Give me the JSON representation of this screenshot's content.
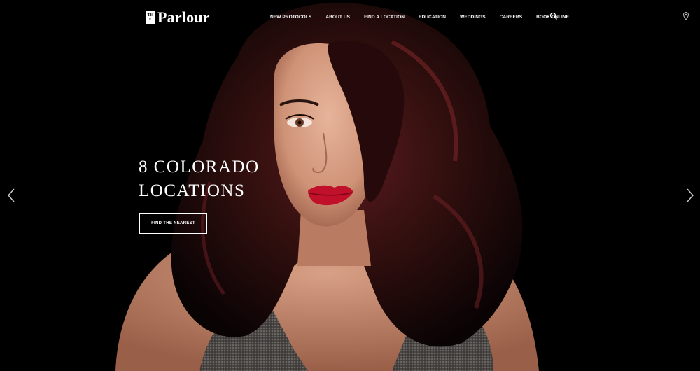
{
  "logo": {
    "the_line1": "TH",
    "the_line2": "E",
    "name": "Parlour"
  },
  "nav": [
    {
      "label": "NEW PROTOCOLS"
    },
    {
      "label": "ABOUT US"
    },
    {
      "label": "FIND A LOCATION"
    },
    {
      "label": "EDUCATION"
    },
    {
      "label": "WEDDINGS"
    },
    {
      "label": "CAREERS"
    },
    {
      "label": "BOOK ONLINE"
    }
  ],
  "icons": {
    "search": "search-icon",
    "location": "map-pin-icon",
    "prev": "chevron-left-icon",
    "next": "chevron-right-icon"
  },
  "slide": {
    "headline_line1": "8 COLORADO",
    "headline_line2": "LOCATIONS",
    "cta_label": "FIND THE NEAREST"
  },
  "colors": {
    "background": "#000000",
    "text": "#ffffff",
    "hair": "#3a1416",
    "lips": "#c0102a",
    "skin": "#d9a38a"
  }
}
